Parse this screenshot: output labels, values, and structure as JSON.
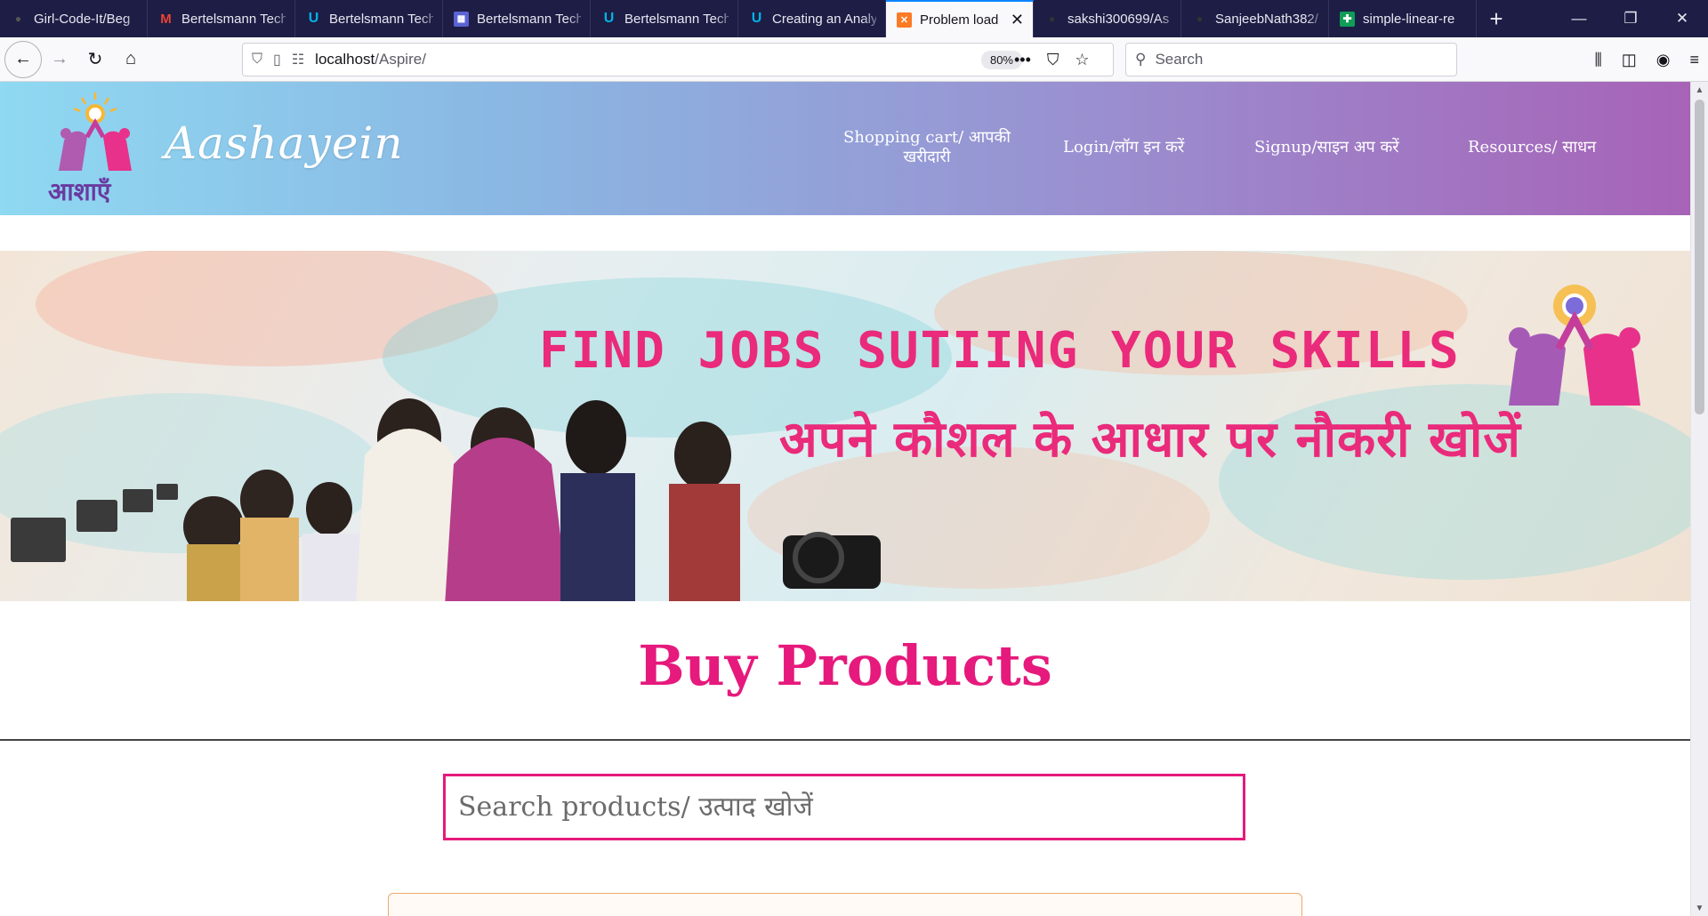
{
  "browser": {
    "tabs": [
      {
        "title": "Girl-Code-It/Beg",
        "icon": "github-icon",
        "active": false
      },
      {
        "title": "Bertelsmann Tech",
        "icon": "gmail-icon",
        "active": false
      },
      {
        "title": "Bertelsmann Tech",
        "icon": "udacity-icon",
        "active": false
      },
      {
        "title": "Bertelsmann Tech",
        "icon": "calendar-icon",
        "active": false
      },
      {
        "title": "Bertelsmann Tech",
        "icon": "udacity-icon",
        "active": false
      },
      {
        "title": "Creating an Analy",
        "icon": "udacity-icon",
        "active": false
      },
      {
        "title": "Problem load",
        "icon": "xampp-icon",
        "active": true
      },
      {
        "title": "sakshi300699/As",
        "icon": "github-icon",
        "active": false
      },
      {
        "title": "SanjeebNath382/",
        "icon": "github-icon",
        "active": false
      },
      {
        "title": "simple-linear-re",
        "icon": "sheets-icon",
        "active": false
      }
    ],
    "url_host": "localhost",
    "url_path": "/Aspire/",
    "zoom": "80%",
    "search_placeholder": "Search"
  },
  "site": {
    "brand": "Aashayein",
    "logo_text": "आशाएँ",
    "nav": {
      "cart_line1": "Shopping cart/ आपकी",
      "cart_line2": "खरीदारी",
      "login": "Login/लॉग इन करें",
      "signup": "Signup/साइन अप करें",
      "resources": "Resources/ साधन"
    },
    "banner": {
      "headline_en": "FIND JOBS SUTIING YOUR SKILLS",
      "headline_hi": "अपने कौशल के आधार पर नौकरी खोजें"
    },
    "page_title": "Buy Products",
    "search_placeholder": "Search products/ उत्पाद खोजें"
  },
  "colors": {
    "accent_pink": "#e6197c",
    "banner_text": "#ea2a7a",
    "header_gradient": [
      "#8fd9f2",
      "#a763b7"
    ],
    "tabstrip_bg": "#1d1d45"
  }
}
